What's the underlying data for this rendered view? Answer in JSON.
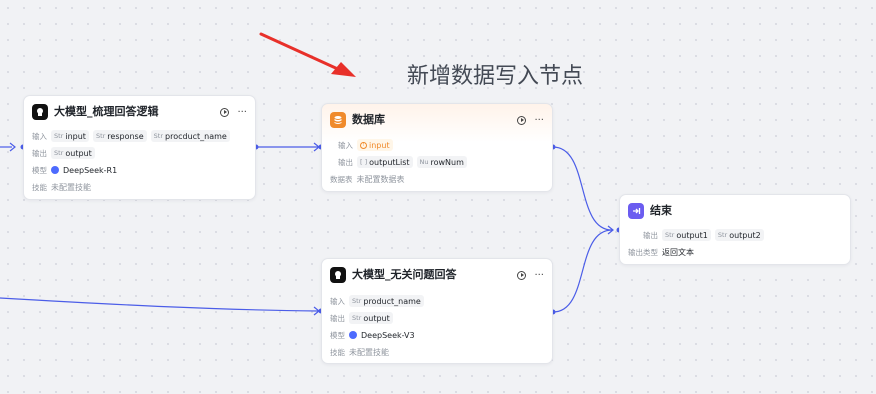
{
  "annotation": {
    "text": "新增数据写入节点",
    "arrow_color": "#e8302a"
  },
  "colors": {
    "wire": "#4b5de8",
    "db_accent": "#f08a2b",
    "end_accent": "#6b5cf0"
  },
  "nodes": {
    "llm1": {
      "title": "大模型_梳理回答逻辑",
      "input_label": "输入",
      "inputs": [
        {
          "type": "Str",
          "name": "input"
        },
        {
          "type": "Str",
          "name": "response"
        },
        {
          "type": "Str",
          "name": "procduct_name"
        }
      ],
      "output_label": "输出",
      "outputs": [
        {
          "type": "Str",
          "name": "output"
        }
      ],
      "model_label": "模型",
      "model": "DeepSeek-R1",
      "skill_label": "技能",
      "skill": "未配置技能"
    },
    "db": {
      "title": "数据库",
      "input_label": "输入",
      "input": "input",
      "output_label": "输出",
      "outputs": [
        {
          "type": "[ ]",
          "name": "outputList"
        },
        {
          "type": "Nu",
          "name": "rowNum"
        }
      ],
      "table_label": "数据表",
      "table": "未配置数据表"
    },
    "end": {
      "title": "结束",
      "output_label": "输出",
      "outputs": [
        {
          "type": "Str",
          "name": "output1"
        },
        {
          "type": "Str",
          "name": "output2"
        }
      ],
      "type_label": "输出类型",
      "type_value": "返回文本"
    },
    "llm2": {
      "title": "大模型_无关问题回答",
      "input_label": "输入",
      "inputs": [
        {
          "type": "Str",
          "name": "product_name"
        }
      ],
      "output_label": "输出",
      "outputs": [
        {
          "type": "Str",
          "name": "output"
        }
      ],
      "model_label": "模型",
      "model": "DeepSeek-V3",
      "skill_label": "技能",
      "skill": "未配置技能"
    }
  }
}
